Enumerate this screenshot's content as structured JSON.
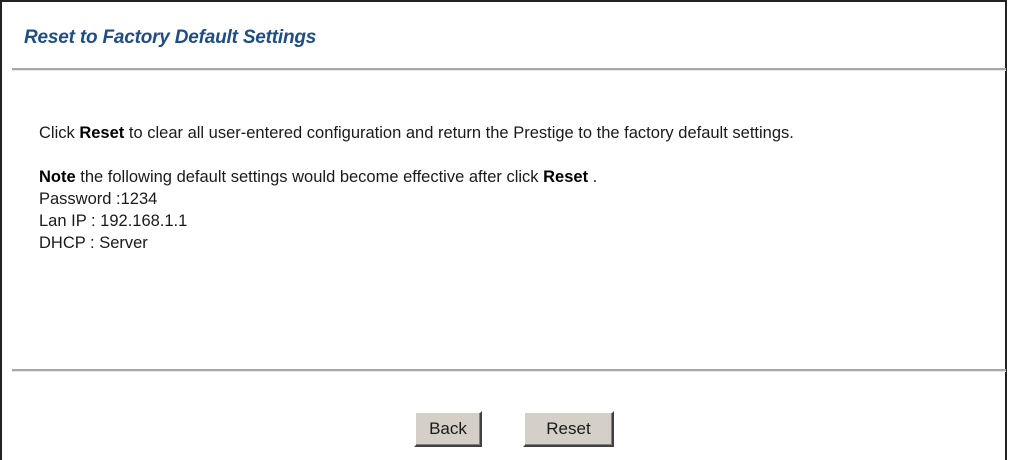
{
  "page": {
    "title": "Reset to Factory Default Settings"
  },
  "intro": {
    "prefix": "Click ",
    "bold": "Reset",
    "suffix": " to clear all user-entered configuration and return the Prestige to the factory default settings."
  },
  "note": {
    "bold_note": "Note",
    "middle": " the following default settings would become effective after click ",
    "bold_reset": "Reset",
    "end": " ."
  },
  "defaults": [
    "Password :1234",
    "Lan IP : 192.168.1.1",
    "DHCP : Server"
  ],
  "buttons": {
    "back_label": "Back",
    "reset_label": "Reset"
  },
  "colors": {
    "title": "#1f4d85",
    "button_face": "#d4d0c8",
    "divider": "#a8a8a8"
  }
}
